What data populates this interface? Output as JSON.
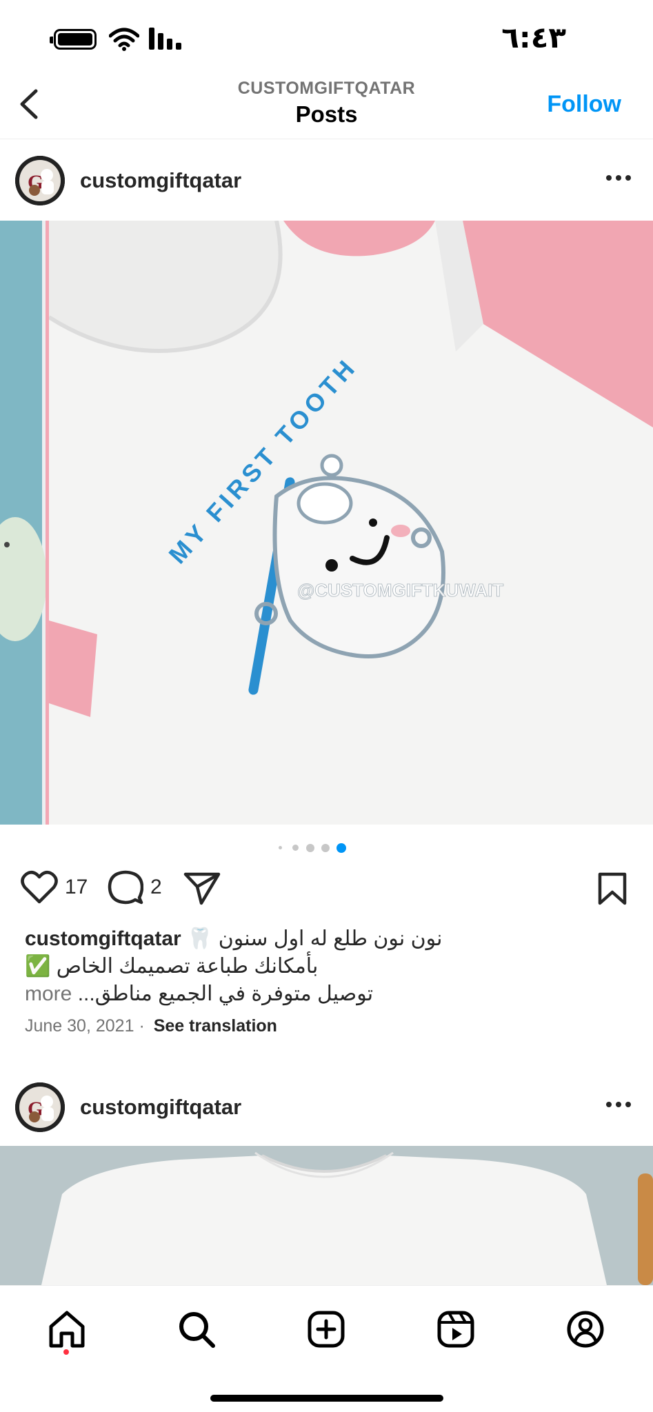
{
  "status_bar": {
    "time": "٦:٤٣",
    "icons": [
      "battery-icon",
      "wifi-icon",
      "signal-icon"
    ]
  },
  "header": {
    "subtitle": "CUSTOMGIFTQATAR",
    "title": "Posts",
    "follow_label": "Follow",
    "back_icon": "chevron-left-icon"
  },
  "post": {
    "username": "customgiftqatar",
    "image_text": {
      "shirt_slogan": "MY FIRST TOOTH",
      "watermark": "@CUSTOMGIFTKUWAIT"
    },
    "carousel": {
      "total": 5,
      "active_index": 4
    },
    "likes": "17",
    "comments": "2",
    "caption_user": "customgiftqatar",
    "caption_line1": "نون نون طلع له اول سنون 🦷",
    "caption_line2": "بأمكانك طباعة تصميمك الخاص ✅",
    "caption_line3": "توصيل متوفرة في الجميع مناطق...",
    "more_label": "more",
    "date": "June 30, 2021",
    "separator": "·",
    "see_translation": "See translation"
  },
  "post2": {
    "username": "customgiftqatar"
  },
  "tab_bar": {
    "items": [
      "home-icon",
      "search-icon",
      "create-icon",
      "reels-icon",
      "profile-icon"
    ]
  },
  "colors": {
    "accent": "#0095f6",
    "notification_dot": "#ff3040",
    "image_pink": "#f1a6b2",
    "image_teal": "#7fb7c4",
    "shirt_text_blue": "#2a8fd0"
  }
}
